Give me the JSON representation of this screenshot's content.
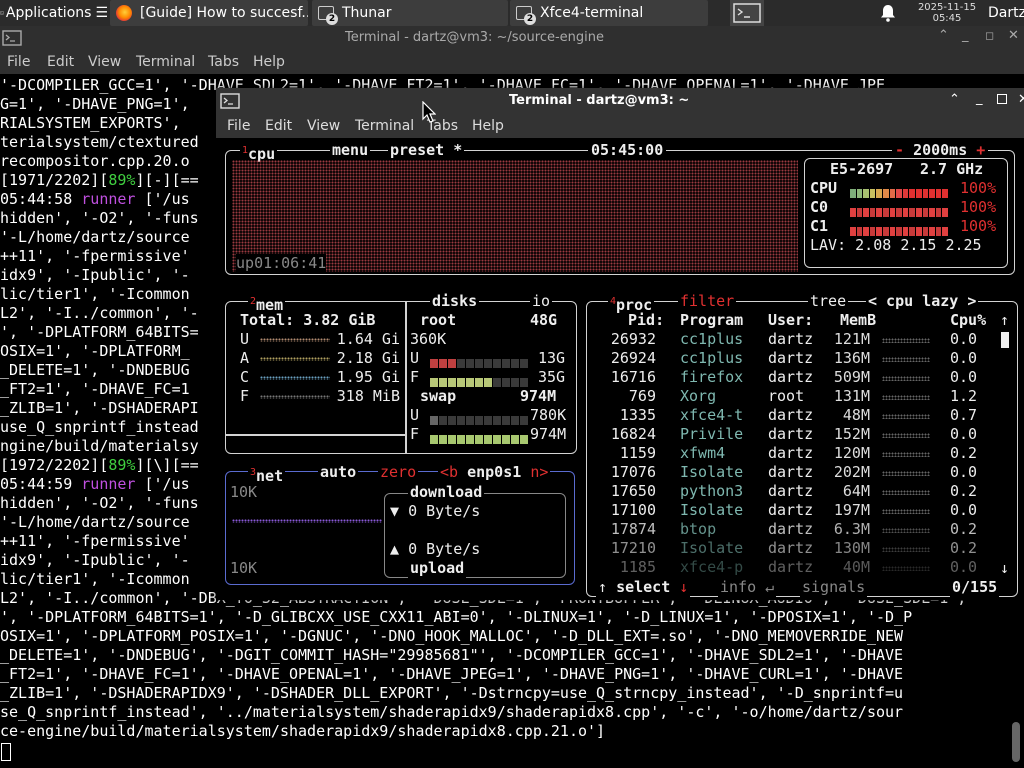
{
  "taskbar": {
    "apps_label": "Applications",
    "windows": [
      {
        "label": "[Guide] How to succesf...",
        "icon": "firefox-icon"
      },
      {
        "label": "Thunar",
        "icon": "file-manager-icon",
        "badge": "2"
      },
      {
        "label": "Xfce4-terminal",
        "icon": "terminal-icon",
        "badge": "2"
      }
    ],
    "date": "2025-11-15",
    "time": "05:45",
    "user": "Dartz"
  },
  "back_window": {
    "title": "Terminal - dartz@vm3: ~/source-engine",
    "menu": [
      "File",
      "Edit",
      "View",
      "Terminal",
      "Tabs",
      "Help"
    ],
    "lines": [
      "'-DCOMPILER_GCC=1', '-DHAVE_SDL2=1', '-DHAVE_FT2=1', '-DHAVE_FC=1', '-DHAVE_OPENAL=1', '-DHAVE_JPE",
      "G=1', '-DHAVE_PNG=1',",
      "RIALSYSTEM_EXPORTS',",
      "terialsystem/ctextured",
      "recompositor.cpp.20.o",
      "[1971/2202][89%][-][==",
      "05:44:58 runner ['/us",
      "hidden', '-O2', '-funs",
      "'-L/home/dartz/source",
      "++11', '-fpermissive'",
      "idx9', '-Ipublic', '-",
      "lic/tier1', '-Icommon",
      "L2', '-I../common', '-",
      "', '-DPLATFORM_64BITS=",
      "OSIX=1', '-DPLATFORM_",
      "_DELETE=1', '-DNDEBUG",
      "_FT2=1', '-DHAVE_FC=1",
      "_ZLIB=1', '-DSHADERAPI",
      "use_Q_snprintf_instead",
      "ngine/build/materialsy",
      "[1972/2202][89%][\\][==",
      "05:44:59 runner ['/us",
      "hidden', '-O2', '-funs",
      "'-L/home/dartz/source",
      "++11', '-fpermissive'",
      "idx9', '-Ipublic', '-",
      "lic/tier1', '-Icommon",
      "L2', '-I../common', '-DBX_TO_32_ABSTRACTION', '-DUSE_SDL=1', 'FRONTBUFFER', '-DLINUX_AUDIO', '-DUSE_SDL=1',",
      "', '-DPLATFORM_64BITS=1', '-D_GLIBCXX_USE_CXX11_ABI=0', '-DLINUX=1', '-D_LINUX=1', '-DPOSIX=1', '-D_P",
      "OSIX=1', '-DPLATFORM_POSIX=1', '-DGNUC', '-DNO_HOOK_MALLOC', '-D_DLL_EXT=.so', '-DNO_MEMOVERRIDE_NEW",
      "_DELETE=1', '-DNDEBUG', '-DGIT_COMMIT_HASH=\"29985681\"', '-DCOMPILER_GCC=1', '-DHAVE_SDL2=1', '-DHAVE",
      "_FT2=1', '-DHAVE_FC=1', '-DHAVE_OPENAL=1', '-DHAVE_JPEG=1', '-DHAVE_PNG=1', '-DHAVE_CURL=1', '-DHAVE",
      "_ZLIB=1', '-DSHADERAPIDX9', '-DSHADER_DLL_EXPORT', '-Dstrncpy=use_Q_strncpy_instead', '-D_snprintf=u",
      "se_Q_snprintf_instead', '../materialsystem/shaderapidx9/shaderapidx8.cpp', '-c', '-o/home/dartz/sour",
      "ce-engine/build/materialsystem/shaderapidx9/shaderapidx8.cpp.21.o']"
    ],
    "progress_pct": "89%",
    "runner_word": "runner"
  },
  "front_window": {
    "title": "Terminal - dartz@vm3: ~",
    "menu": [
      "File",
      "Edit",
      "View",
      "Terminal",
      "Tabs",
      "Help"
    ]
  },
  "btop": {
    "cpu_box": {
      "tab_num": "1",
      "tab_cpu": "cpu",
      "tab_menu": "menu",
      "tab_preset": "preset *",
      "clock": "05:45:00",
      "interval": "2000ms",
      "minus": "-",
      "plus": "+",
      "model": "E5-2697",
      "freq": "2.7 GHz",
      "rows": [
        {
          "label": "CPU",
          "pct": "100%",
          "level": 1.0
        },
        {
          "label": "C0",
          "pct": "100%",
          "level": 1.0
        },
        {
          "label": "C1",
          "pct": "100%",
          "level": 1.0
        }
      ],
      "lav_label": "LAV:",
      "lav": [
        "2.08",
        "2.15",
        "2.25"
      ],
      "uptime_label": "up",
      "uptime": "01:06:41"
    },
    "mem_box": {
      "tab_num": "2",
      "title": "mem",
      "total_label": "Total:",
      "total": "3.82 GiB",
      "rows": [
        {
          "label": "U",
          "value": "1.64 Gi"
        },
        {
          "label": "A",
          "value": "2.18 Gi"
        },
        {
          "label": "C",
          "value": "1.95 Gi"
        },
        {
          "label": "F",
          "value": "318 MiB"
        }
      ]
    },
    "disks_box": {
      "title": "disks",
      "io": "io",
      "root": {
        "name": "root",
        "size": "48G",
        "rate": "360K",
        "used": "13G",
        "free": "35G",
        "used_label": "U",
        "free_label": "F"
      },
      "swap": {
        "name": "swap",
        "size": "974M",
        "used": "780K",
        "free": "974M",
        "used_label": "U",
        "free_label": "F"
      }
    },
    "net_box": {
      "tab_num": "3",
      "title": "net",
      "auto": "auto",
      "zero": "zero",
      "iface": "enp0s1",
      "prev": "<b",
      "next": "n>",
      "scale_top": "10K",
      "scale_bottom": "10K",
      "download_label": "download",
      "download": "0 Byte/s",
      "upload_label": "upload",
      "upload": "0 Byte/s",
      "down_arrow": "▼",
      "up_arrow": "▲"
    },
    "proc_box": {
      "tab_num": "4",
      "title": "proc",
      "filter": "filter",
      "tree": "tree",
      "sort": "< cpu lazy >",
      "headers": {
        "pid": "Pid:",
        "program": "Program",
        "user": "User:",
        "mem": "MemB",
        "cpu": "Cpu%"
      },
      "rows": [
        {
          "pid": "26932",
          "program": "cc1plus",
          "user": "dartz",
          "mem": "121M",
          "cpu": "0.0"
        },
        {
          "pid": "26924",
          "program": "cc1plus",
          "user": "dartz",
          "mem": "136M",
          "cpu": "0.0"
        },
        {
          "pid": "16716",
          "program": "firefox",
          "user": "dartz",
          "mem": "509M",
          "cpu": "0.0"
        },
        {
          "pid": "769",
          "program": "Xorg",
          "user": "root",
          "mem": "131M",
          "cpu": "1.2"
        },
        {
          "pid": "1335",
          "program": "xfce4-t",
          "user": "dartz",
          "mem": "48M",
          "cpu": "0.7"
        },
        {
          "pid": "16824",
          "program": "Privile",
          "user": "dartz",
          "mem": "152M",
          "cpu": "0.0"
        },
        {
          "pid": "1159",
          "program": "xfwm4",
          "user": "dartz",
          "mem": "120M",
          "cpu": "0.2"
        },
        {
          "pid": "17076",
          "program": "Isolate",
          "user": "dartz",
          "mem": "202M",
          "cpu": "0.0"
        },
        {
          "pid": "17650",
          "program": "python3",
          "user": "dartz",
          "mem": "64M",
          "cpu": "0.2"
        },
        {
          "pid": "17100",
          "program": "Isolate",
          "user": "dartz",
          "mem": "197M",
          "cpu": "0.0"
        },
        {
          "pid": "17874",
          "program": "btop",
          "user": "dartz",
          "mem": "6.3M",
          "cpu": "0.2"
        },
        {
          "pid": "17210",
          "program": "Isolate",
          "user": "dartz",
          "mem": "130M",
          "cpu": "0.2"
        },
        {
          "pid": "1185",
          "program": "xfce4-p",
          "user": "dartz",
          "mem": "40M",
          "cpu": "0.0"
        }
      ],
      "footer": {
        "select": "select",
        "info": "info",
        "signals": "signals",
        "count": "0/155",
        "up": "↑",
        "down": "↓",
        "enter": "↵"
      }
    }
  },
  "colors": {
    "green": "#40d040",
    "purple": "#c050e0",
    "cpu_red": "#e03030",
    "graph_dot": "#9a3a40",
    "accent": "#e03030",
    "cyan_proc": "#7fb8b0"
  }
}
